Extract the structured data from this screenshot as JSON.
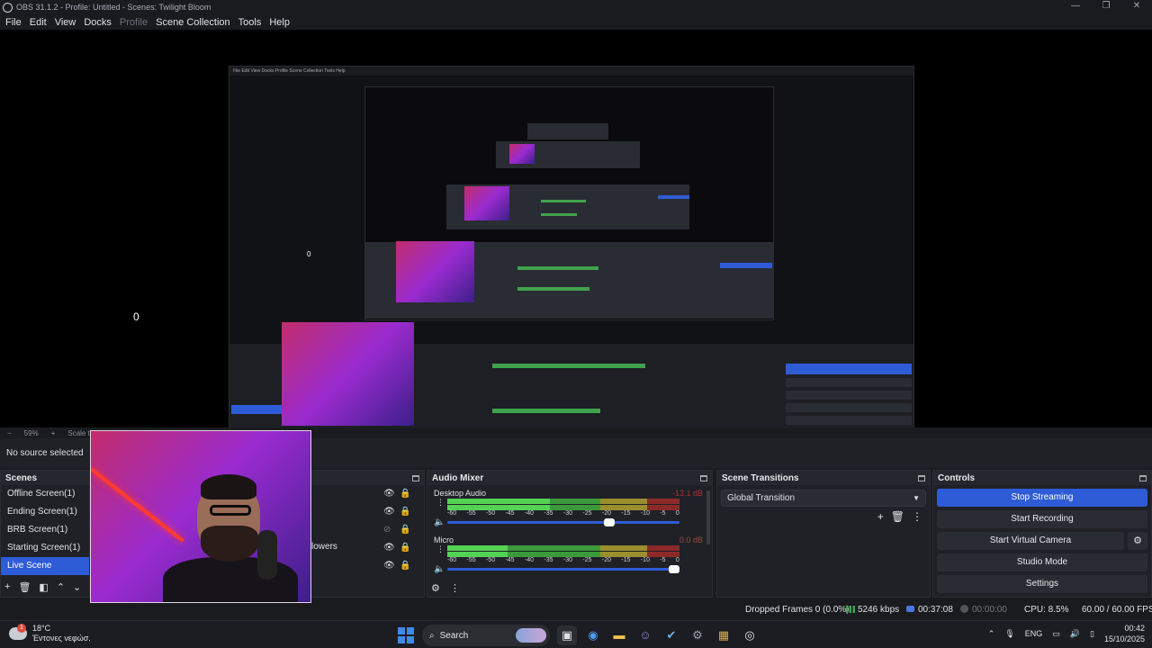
{
  "window": {
    "title": "OBS 31.1.2 - Profile: Untitled - Scenes: Twilight Bloom",
    "controls": [
      "—",
      "❐",
      "✕"
    ]
  },
  "menu": {
    "file": "File",
    "edit": "Edit",
    "view": "View",
    "docks": "Docks",
    "profile": "Profile",
    "scene_collection": "Scene Collection",
    "tools": "Tools",
    "help": "Help"
  },
  "preview": {
    "nested_menu": "File  Edit  View  Docks  Profile  Scene Collection  Tools  Help",
    "zero_marks": [
      "0",
      "0"
    ]
  },
  "zoom": {
    "minus": "−",
    "value": "59%",
    "plus": "+",
    "scale_label": "Scale to W"
  },
  "source_bar": {
    "text": "No source selected"
  },
  "scenes": {
    "title": "Scenes",
    "items": [
      {
        "label": "Offline Screen(1)"
      },
      {
        "label": "Ending Screen(1)"
      },
      {
        "label": "BRB Screen(1)"
      },
      {
        "label": "Starting Screen(1)"
      },
      {
        "label": "Live Scene"
      }
    ],
    "active_index": 4
  },
  "sources": {
    "visible_fragment": "lowers"
  },
  "mixer": {
    "title": "Audio Mixer",
    "channels": [
      {
        "name": "Desktop Audio",
        "db": "-13.1 dB",
        "level": 0.44,
        "volume": 0.72
      },
      {
        "name": "Micro",
        "db": "0.0 dB",
        "level": 0.26,
        "volume": 1.0
      }
    ],
    "ticks": [
      "-60",
      "-55",
      "-50",
      "-45",
      "-40",
      "-35",
      "-30",
      "-25",
      "-20",
      "-15",
      "-10",
      "-5",
      "0"
    ]
  },
  "transitions": {
    "title": "Scene Transitions",
    "selected": "Global Transition"
  },
  "controls": {
    "title": "Controls",
    "stop_streaming": "Stop Streaming",
    "start_recording": "Start Recording",
    "start_virtual_camera": "Start Virtual Camera",
    "studio_mode": "Studio Mode",
    "settings": "Settings"
  },
  "status": {
    "dropped_frames": "Dropped Frames 0 (0.0%)",
    "bitrate": "5246 kbps",
    "stream_time": "00:37:08",
    "rec_time": "00:00:00",
    "cpu": "CPU: 8.5%",
    "fps": "60.00 / 60.00 FPS"
  },
  "taskbar": {
    "weather_temp": "18°C",
    "weather_desc": "Έντονες νεφώσ.",
    "weather_badge": "1",
    "search_label": "Search",
    "lang": "ENG",
    "time": "00:42",
    "date": "15/10/2025"
  },
  "colors": {
    "accent": "#2e5bd6",
    "background": "#1f2127",
    "meter_green": "#54d254"
  }
}
